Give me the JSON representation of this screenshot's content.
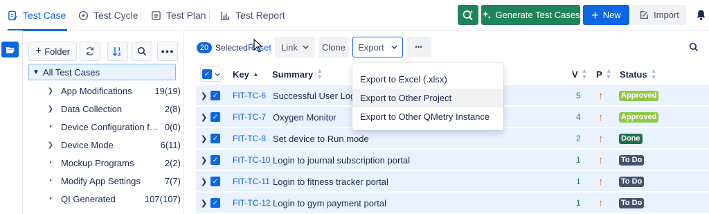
{
  "nav": {
    "tabs": [
      {
        "label": "Test Case",
        "icon": "test-case-icon",
        "active": true
      },
      {
        "label": "Test Cycle",
        "icon": "test-cycle-icon"
      },
      {
        "label": "Test Plan",
        "icon": "test-plan-icon"
      },
      {
        "label": "Test Report",
        "icon": "bar-chart-icon"
      }
    ],
    "ai_button_icon": "ai-search-icon",
    "generate_label": "Generate Test Cases",
    "new_label": "New",
    "import_label": "Import",
    "notification_icon": "bell-icon"
  },
  "sidebar": {
    "folder_button_label": "Folder",
    "root_label": "All Test Cases",
    "items": [
      {
        "label": "App Modifications",
        "count": "19(19)",
        "type": "folder"
      },
      {
        "label": "Data Collection",
        "count": "2(8)",
        "type": "folder"
      },
      {
        "label": "Device Configuration fo...",
        "count": "0(0)",
        "type": "leaf"
      },
      {
        "label": "Device Mode",
        "count": "6(11)",
        "type": "folder"
      },
      {
        "label": "Mockup Programs",
        "count": "2(2)",
        "type": "leaf"
      },
      {
        "label": "Modify App Settings",
        "count": "7(7)",
        "type": "leaf"
      },
      {
        "label": "QI Generated",
        "count": "107(107)",
        "type": "leaf"
      }
    ]
  },
  "toolbar": {
    "selected_count": "20",
    "selected_label": "Selected",
    "reset_label": "Reset",
    "link_label": "Link",
    "clone_label": "Clone",
    "export_label": "Export",
    "more_label": "•••"
  },
  "table": {
    "columns": {
      "key": "Key",
      "summary": "Summary",
      "version": "V",
      "priority": "P",
      "status": "Status"
    },
    "rows": [
      {
        "key": "FIT-TC-6",
        "summary": "Successful User Login",
        "version": "5",
        "status": "Approved"
      },
      {
        "key": "FIT-TC-7",
        "summary": "Oxygen Monitor",
        "version": "4",
        "status": "Approved"
      },
      {
        "key": "FIT-TC-8",
        "summary": "Set device to Run mode",
        "version": "2",
        "status": "Done"
      },
      {
        "key": "FIT-TC-10",
        "summary": "Login to journal subscription portal",
        "version": "1",
        "status": "To Do"
      },
      {
        "key": "FIT-TC-11",
        "summary": "Login to fitness tracker portal",
        "version": "1",
        "status": "To Do"
      },
      {
        "key": "FIT-TC-12",
        "summary": "Login to gym payment portal",
        "version": "1",
        "status": "To Do"
      }
    ]
  },
  "export_menu": {
    "items": [
      "Export to Excel (.xlsx)",
      "Export to Other Project",
      "Export to Other QMetry Instance"
    ],
    "hovered_index": 1
  },
  "colors": {
    "primary": "#0c66e4",
    "ai_green": "#1f845a",
    "approved": "#94c748",
    "done": "#216e4e",
    "todo": "#44546f"
  }
}
